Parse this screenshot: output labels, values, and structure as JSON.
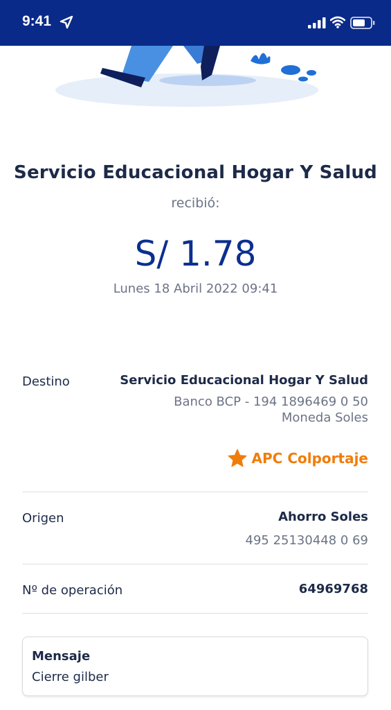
{
  "status_bar": {
    "time": "9:41",
    "icons": [
      "location-arrow-icon",
      "cellular-signal-icon",
      "wifi-icon",
      "battery-icon"
    ]
  },
  "receipt": {
    "recipient_name": "Servicio Educacional Hogar Y Salud",
    "received_label": "recibió:",
    "amount": "S/ 1.78",
    "datetime": "Lunes 18 Abril 2022 09:41"
  },
  "details": {
    "destino": {
      "label": "Destino",
      "name": "Servicio Educacional Hogar Y Salud",
      "account": "Banco BCP - 194 1896469 0 50",
      "currency": "Moneda Soles",
      "favorite_label": "APC Colportaje",
      "favorite_icon": "star-icon"
    },
    "origen": {
      "label": "Origen",
      "account_type": "Ahorro Soles",
      "account_number": "495 25130448 0 69"
    },
    "operacion": {
      "label": "Nº de operación",
      "number": "64969768"
    }
  },
  "message": {
    "title": "Mensaje",
    "text": "Cierre gilber"
  },
  "colors": {
    "header_bg": "#0a2a8a",
    "amount": "#0b2f8f",
    "favorite": "#f07d0a",
    "text_primary": "#1d2a48",
    "text_secondary": "#6b7385"
  }
}
